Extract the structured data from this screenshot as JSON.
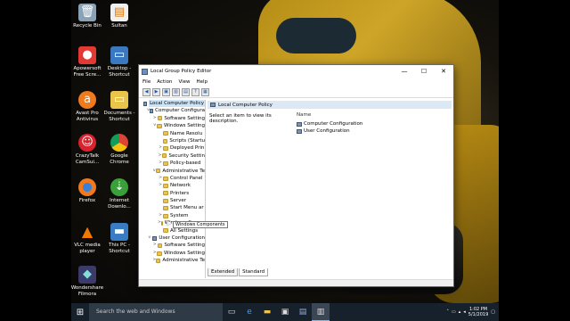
{
  "desktop": {
    "icons": [
      {
        "label": "Recycle Bin",
        "icon": "recycle-bin-icon"
      },
      {
        "label": "Sultan",
        "icon": "document-icon"
      },
      {
        "label": "Apowersoft Free Scre...",
        "icon": "recorder-icon"
      },
      {
        "label": "Desktop - Shortcut",
        "icon": "folder-icon"
      },
      {
        "label": "Avast Pro Antivirus",
        "icon": "avast-icon"
      },
      {
        "label": "Documents - Shortcut",
        "icon": "folder-icon"
      },
      {
        "label": "CrazyTalk CamSui...",
        "icon": "crazytalk-icon"
      },
      {
        "label": "Google Chrome",
        "icon": "chrome-icon"
      },
      {
        "label": "Firefox",
        "icon": "firefox-icon"
      },
      {
        "label": "Internet Downlo...",
        "icon": "idm-icon"
      },
      {
        "label": "VLC media player",
        "icon": "vlc-icon"
      },
      {
        "label": "This PC - Shortcut",
        "icon": "computer-icon"
      },
      {
        "label": "Wondershare Filmora",
        "icon": "filmora-icon"
      }
    ]
  },
  "window": {
    "title": "Local Group Policy Editor",
    "controls": {
      "minimize": "—",
      "maximize": "☐",
      "close": "✕"
    },
    "menu": [
      "File",
      "Action",
      "View",
      "Help"
    ],
    "tree": [
      {
        "label": "Local Computer Policy",
        "level": 0,
        "expander": "",
        "kind": "pc",
        "selected": true
      },
      {
        "label": "Computer Configura",
        "level": 1,
        "expander": "v",
        "kind": "pc"
      },
      {
        "label": "Software Setting",
        "level": 2,
        "expander": ">",
        "kind": "folder"
      },
      {
        "label": "Windows Setting",
        "level": 2,
        "expander": "v",
        "kind": "folder"
      },
      {
        "label": "Name Resolu",
        "level": 3,
        "expander": "",
        "kind": "folder"
      },
      {
        "label": "Scripts (Startu",
        "level": 3,
        "expander": "",
        "kind": "folder"
      },
      {
        "label": "Deployed Prin",
        "level": 3,
        "expander": ">",
        "kind": "folder"
      },
      {
        "label": "Security Settin",
        "level": 3,
        "expander": ">",
        "kind": "folder"
      },
      {
        "label": "Policy-based",
        "level": 3,
        "expander": ">",
        "kind": "folder"
      },
      {
        "label": "Administrative Te",
        "level": 2,
        "expander": "v",
        "kind": "folder"
      },
      {
        "label": "Control Panel",
        "level": 3,
        "expander": ">",
        "kind": "folder"
      },
      {
        "label": "Network",
        "level": 3,
        "expander": ">",
        "kind": "folder"
      },
      {
        "label": "Printers",
        "level": 3,
        "expander": "",
        "kind": "folder"
      },
      {
        "label": "Server",
        "level": 3,
        "expander": "",
        "kind": "folder"
      },
      {
        "label": "Start Menu ar",
        "level": 3,
        "expander": "",
        "kind": "folder"
      },
      {
        "label": "System",
        "level": 3,
        "expander": ">",
        "kind": "folder"
      },
      {
        "label": "Windows Compo",
        "level": 3,
        "expander": ">",
        "kind": "folder"
      },
      {
        "label": "All Settings",
        "level": 3,
        "expander": "",
        "kind": "folder"
      },
      {
        "label": "User Configuration",
        "level": 1,
        "expander": "v",
        "kind": "pc"
      },
      {
        "label": "Software Setting",
        "level": 2,
        "expander": ">",
        "kind": "folder"
      },
      {
        "label": "Windows Setting",
        "level": 2,
        "expander": ">",
        "kind": "folder"
      },
      {
        "label": "Administrative Te",
        "level": 2,
        "expander": ">",
        "kind": "folder"
      }
    ],
    "right_pane": {
      "header": "Local Computer Policy",
      "description": "Select an item to view its description.",
      "column_name": "Name",
      "items": [
        "Computer Configuration",
        "User Configuration"
      ]
    },
    "tabs": [
      "Extended",
      "Standard"
    ],
    "tooltip": "Windows Components"
  },
  "taskbar": {
    "search_placeholder": "Search the web and Windows",
    "time": "1:02 PM",
    "date": "5/1/2019"
  }
}
